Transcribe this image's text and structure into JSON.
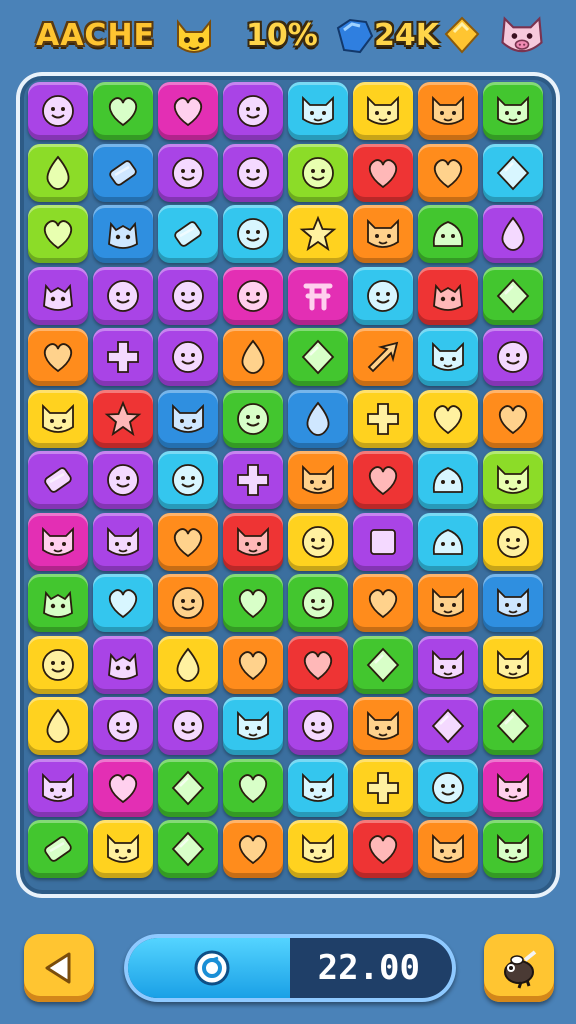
{
  "hud": {
    "title": "AACHE",
    "percent": "10%",
    "coins": "24K",
    "left_avatar_icon": "cat-face-icon",
    "gem_icon": "blue-gem-icon",
    "coin_icon": "gold-coin-icon",
    "right_avatar_icon": "pig-face-icon"
  },
  "board": {
    "rows": [
      [
        [
          "purple",
          "face"
        ],
        [
          "green",
          "heart"
        ],
        [
          "magenta",
          "heart"
        ],
        [
          "purple",
          "face"
        ],
        [
          "cyan",
          "cat"
        ],
        [
          "yellow",
          "cat"
        ],
        [
          "orange",
          "cat"
        ],
        [
          "green",
          "cat"
        ]
      ],
      [
        [
          "lime",
          "drop"
        ],
        [
          "blue",
          "candy"
        ],
        [
          "purple",
          "face"
        ],
        [
          "purple",
          "face"
        ],
        [
          "lime",
          "face"
        ],
        [
          "red",
          "heart"
        ],
        [
          "orange",
          "heart"
        ],
        [
          "cyan",
          "diamond"
        ]
      ],
      [
        [
          "lime",
          "heart"
        ],
        [
          "blue",
          "monster"
        ],
        [
          "cyan",
          "candy"
        ],
        [
          "cyan",
          "face"
        ],
        [
          "yellow",
          "star"
        ],
        [
          "orange",
          "cat"
        ],
        [
          "green",
          "slime"
        ],
        [
          "purple",
          "drop"
        ]
      ],
      [
        [
          "purple",
          "monster"
        ],
        [
          "purple",
          "face"
        ],
        [
          "purple",
          "face"
        ],
        [
          "magenta",
          "face"
        ],
        [
          "magenta",
          "symbol"
        ],
        [
          "cyan",
          "face"
        ],
        [
          "red",
          "monster"
        ],
        [
          "green",
          "diamond"
        ]
      ],
      [
        [
          "orange",
          "heart"
        ],
        [
          "purple",
          "cross"
        ],
        [
          "purple",
          "face"
        ],
        [
          "orange",
          "drop"
        ],
        [
          "green",
          "diamond"
        ],
        [
          "orange",
          "arrow"
        ],
        [
          "cyan",
          "cat"
        ],
        [
          "purple",
          "face"
        ]
      ],
      [
        [
          "yellow",
          "cat"
        ],
        [
          "red",
          "star"
        ],
        [
          "blue",
          "cat"
        ],
        [
          "green",
          "face"
        ],
        [
          "blue",
          "drop"
        ],
        [
          "yellow",
          "cross"
        ],
        [
          "yellow",
          "heart"
        ],
        [
          "orange",
          "heart"
        ]
      ],
      [
        [
          "purple",
          "candy"
        ],
        [
          "purple",
          "face"
        ],
        [
          "cyan",
          "face"
        ],
        [
          "purple",
          "cross"
        ],
        [
          "orange",
          "cat"
        ],
        [
          "red",
          "heart"
        ],
        [
          "cyan",
          "slime"
        ],
        [
          "lime",
          "cat"
        ]
      ],
      [
        [
          "magenta",
          "cat"
        ],
        [
          "purple",
          "cat"
        ],
        [
          "orange",
          "heart"
        ],
        [
          "red",
          "cat"
        ],
        [
          "yellow",
          "face"
        ],
        [
          "purple",
          "square"
        ],
        [
          "cyan",
          "slime"
        ],
        [
          "yellow",
          "face"
        ]
      ],
      [
        [
          "green",
          "monster"
        ],
        [
          "cyan",
          "heart"
        ],
        [
          "orange",
          "face"
        ],
        [
          "green",
          "heart"
        ],
        [
          "green",
          "face"
        ],
        [
          "orange",
          "heart"
        ],
        [
          "orange",
          "cat"
        ],
        [
          "blue",
          "cat"
        ]
      ],
      [
        [
          "yellow",
          "face"
        ],
        [
          "purple",
          "monster"
        ],
        [
          "yellow",
          "drop"
        ],
        [
          "orange",
          "heart"
        ],
        [
          "red",
          "heart"
        ],
        [
          "green",
          "diamond"
        ],
        [
          "purple",
          "cat"
        ],
        [
          "yellow",
          "cat"
        ]
      ],
      [
        [
          "yellow",
          "drop"
        ],
        [
          "purple",
          "face"
        ],
        [
          "purple",
          "face"
        ],
        [
          "cyan",
          "cat"
        ],
        [
          "purple",
          "face"
        ],
        [
          "orange",
          "cat"
        ],
        [
          "purple",
          "diamond"
        ],
        [
          "green",
          "diamond"
        ]
      ],
      [
        [
          "purple",
          "cat"
        ],
        [
          "magenta",
          "heart"
        ],
        [
          "green",
          "diamond"
        ],
        [
          "green",
          "heart"
        ],
        [
          "cyan",
          "cat"
        ],
        [
          "yellow",
          "cross"
        ],
        [
          "cyan",
          "face"
        ],
        [
          "magenta",
          "cat"
        ]
      ],
      [
        [
          "green",
          "candy"
        ],
        [
          "yellow",
          "cat"
        ],
        [
          "green",
          "diamond"
        ],
        [
          "orange",
          "heart"
        ],
        [
          "yellow",
          "cat"
        ],
        [
          "red",
          "heart"
        ],
        [
          "orange",
          "cat"
        ],
        [
          "green",
          "cat"
        ]
      ]
    ]
  },
  "footer": {
    "back_icon": "back-arrow-icon",
    "timer_icon": "clock-icon",
    "timer_value": "22.00",
    "timer_fraction": 0.5,
    "tool_icon": "hammer-tool-icon"
  },
  "colors": {
    "purple": "#a944e6",
    "green": "#43c62f",
    "magenta": "#e32fb4",
    "cyan": "#34c6ee",
    "yellow": "#ffd21f",
    "orange": "#ff8c1c",
    "lime": "#8cdc28",
    "blue": "#2f8fe0",
    "red": "#ee3434"
  }
}
